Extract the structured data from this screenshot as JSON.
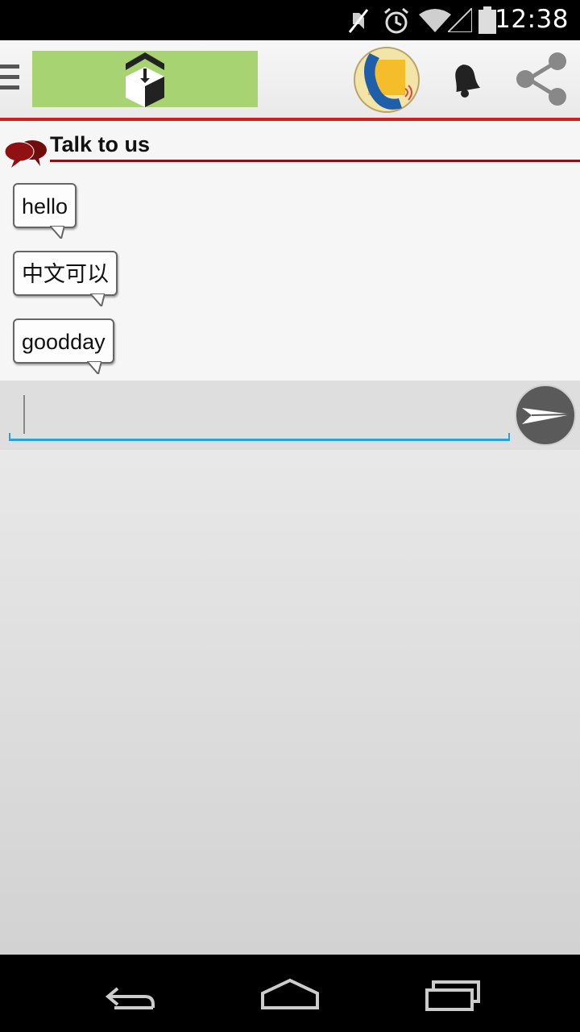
{
  "status_bar": {
    "time": "12:38",
    "icons": [
      "mute-icon",
      "alarm-icon",
      "wifi-icon",
      "signal-icon",
      "battery-icon"
    ]
  },
  "app_bar": {
    "icons": [
      "menu-icon",
      "logo",
      "phone-call-icon",
      "bell-icon",
      "share-icon"
    ],
    "colors": {
      "logo_bg": "#a8d372",
      "accent_rule": "#d41d1d"
    }
  },
  "section": {
    "title": "Talk to us",
    "icon": "chat-bubbles-icon",
    "rule_color": "#8f1111"
  },
  "messages": [
    {
      "text": "hello"
    },
    {
      "text": "中文可以"
    },
    {
      "text": "goodday"
    }
  ],
  "composer": {
    "value": "",
    "placeholder": "",
    "send_icon": "send-icon",
    "underline_color": "#2ba1d6"
  },
  "nav_bar": {
    "icons": [
      "back-icon",
      "home-icon",
      "recents-icon"
    ]
  }
}
